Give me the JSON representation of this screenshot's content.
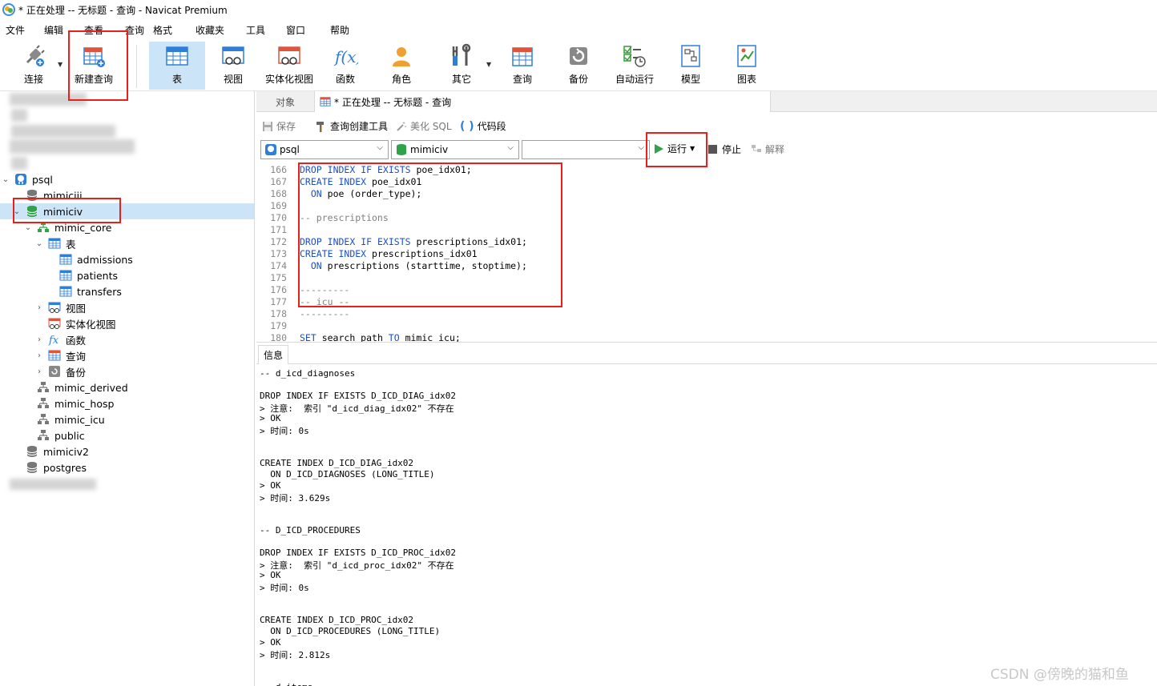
{
  "window": {
    "title": "* 正在处理 -- 无标题 - 查询 - Navicat Premium"
  },
  "menu": [
    "文件",
    "编辑",
    "查看",
    "查询",
    "格式",
    "收藏夹",
    "工具",
    "窗口",
    "帮助"
  ],
  "toolbar": {
    "connect": "连接",
    "new_query": "新建查询",
    "table": "表",
    "view": "视图",
    "mat_view": "实体化视图",
    "function": "函数",
    "role": "角色",
    "other": "其它",
    "query": "查询",
    "backup": "备份",
    "auto_run": "自动运行",
    "model": "模型",
    "chart": "图表"
  },
  "navigator": {
    "connection": "psql",
    "db_mimiciii": "mimiciii",
    "db_mimiciv": "mimiciv",
    "schema_core": "mimic_core",
    "tables_folder": "表",
    "tables": [
      "admissions",
      "patients",
      "transfers"
    ],
    "views_folder": "视图",
    "matviews_folder": "实体化视图",
    "functions_folder": "函数",
    "queries_folder": "查询",
    "backups_folder": "备份",
    "schema_derived": "mimic_derived",
    "schema_hosp": "mimic_hosp",
    "schema_icu": "mimic_icu",
    "schema_public": "public",
    "db_mimiciv2": "mimiciv2",
    "db_postgres": "postgres"
  },
  "tabs": {
    "objects": "对象",
    "query": "* 正在处理 -- 无标题 - 查询"
  },
  "query_toolbar": {
    "save": "保存",
    "builder": "查询创建工具",
    "beautify": "美化 SQL",
    "snippet": "代码段"
  },
  "selectors": {
    "connection": "psql",
    "database": "mimiciv",
    "schema": "",
    "run": "运行",
    "stop": "停止",
    "explain": "解释"
  },
  "editor": {
    "lines": [
      {
        "n": "166",
        "code": "DROP INDEX IF EXISTS poe_idx01;"
      },
      {
        "n": "167",
        "code": "CREATE INDEX poe_idx01"
      },
      {
        "n": "168",
        "code": "  ON poe (order_type);"
      },
      {
        "n": "169",
        "code": ""
      },
      {
        "n": "170",
        "code": "-- prescriptions"
      },
      {
        "n": "171",
        "code": ""
      },
      {
        "n": "172",
        "code": "DROP INDEX IF EXISTS prescriptions_idx01;"
      },
      {
        "n": "173",
        "code": "CREATE INDEX prescriptions_idx01"
      },
      {
        "n": "174",
        "code": "  ON prescriptions (starttime, stoptime);"
      },
      {
        "n": "175",
        "code": ""
      },
      {
        "n": "176",
        "code": "---------"
      },
      {
        "n": "177",
        "code": "-- icu --"
      },
      {
        "n": "178",
        "code": "---------"
      },
      {
        "n": "179",
        "code": ""
      },
      {
        "n": "180",
        "code": "SET search_path TO mimic_icu;"
      }
    ]
  },
  "info_tab": "信息",
  "output": [
    "-- d_icd_diagnoses",
    "",
    "DROP INDEX IF EXISTS D_ICD_DIAG_idx02",
    "> 注意:  索引 \"d_icd_diag_idx02\" 不存在",
    "> OK",
    "> 时间: 0s",
    "",
    "",
    "CREATE INDEX D_ICD_DIAG_idx02",
    "  ON D_ICD_DIAGNOSES (LONG_TITLE)",
    "> OK",
    "> 时间: 3.629s",
    "",
    "",
    "-- D_ICD_PROCEDURES",
    "",
    "DROP INDEX IF EXISTS D_ICD_PROC_idx02",
    "> 注意:  索引 \"d_icd_proc_idx02\" 不存在",
    "> OK",
    "> 时间: 0s",
    "",
    "",
    "CREATE INDEX D_ICD_PROC_idx02",
    "  ON D_ICD_PROCEDURES (LONG_TITLE)",
    "> OK",
    "> 时间: 2.812s",
    "",
    "",
    "-- d_items"
  ],
  "watermark": "CSDN @傍晚的猫和鱼",
  "colors": {
    "highlight": "#e8201b",
    "selection": "#cce4f7",
    "keyword": "#1a4fc9",
    "comment": "#808080"
  }
}
